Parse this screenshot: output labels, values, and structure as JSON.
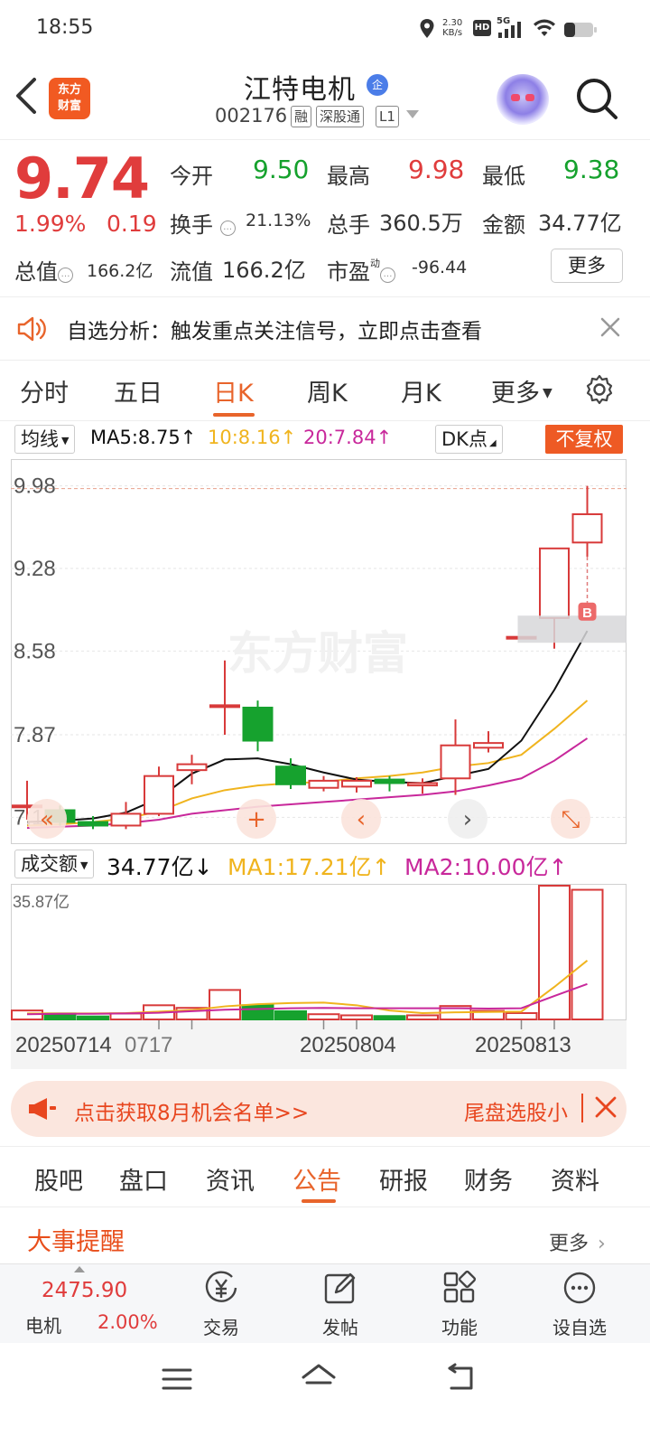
{
  "status_bar": {
    "time": "18:55",
    "net_speed_value": "2.30",
    "net_speed_unit": "KB/s",
    "hd_label": "HD",
    "network_label": "5G"
  },
  "header": {
    "logo_line1": "东方",
    "logo_line2": "财富",
    "stock_name": "江特电机",
    "badge": "企",
    "stock_code": "002176",
    "tags": [
      "融",
      "深股通",
      "L1"
    ]
  },
  "quote": {
    "price": "9.74",
    "change_pct": "1.99%",
    "change_amt": "0.19",
    "open_label": "今开",
    "open": "9.50",
    "high_label": "最高",
    "high": "9.98",
    "low_label": "最低",
    "low": "9.38",
    "turnover_label": "换手",
    "turnover": "21.13%",
    "volume_label": "总手",
    "volume": "360.5万",
    "amount_label": "金额",
    "amount": "34.77亿",
    "mktcap_label": "总值",
    "mktcap": "166.2亿",
    "float_label": "流值",
    "float_cap": "166.2亿",
    "pe_label": "市盈",
    "pe_sup": "动",
    "pe": "-96.44",
    "more": "更多"
  },
  "alert": {
    "text": "自选分析：触发重点关注信号，立即点击查看"
  },
  "chart_tabs": [
    "分时",
    "五日",
    "日K",
    "周K",
    "月K",
    "更多"
  ],
  "active_chart_tab": "日K",
  "indicators": {
    "ma_selector": "均线",
    "ma5": "MA5:8.75",
    "ma10": "10:8.16",
    "ma20": "20:7.84",
    "dk_button": "DK点",
    "adjust_button": "不复权",
    "ma5_color": "#111111",
    "ma10_color": "#f0b41e",
    "ma20_color": "#c8289b"
  },
  "chart_data": {
    "type": "candlestick",
    "y_ticks": [
      "9.98",
      "9.28",
      "8.58",
      "7.87",
      "7.17"
    ],
    "ylim": [
      7.05,
      10.1
    ],
    "x_labels": [
      "20250714",
      "0717",
      "20250804",
      "20250813"
    ],
    "watermark": "东方财富",
    "buy_marker": "B",
    "candles": [
      {
        "o": 7.27,
        "c": 7.27,
        "h": 7.48,
        "l": 7.15
      },
      {
        "o": 7.23,
        "c": 7.13,
        "h": 7.27,
        "l": 7.1
      },
      {
        "o": 7.13,
        "c": 7.1,
        "h": 7.18,
        "l": 7.07
      },
      {
        "o": 7.1,
        "c": 7.2,
        "h": 7.3,
        "l": 7.07
      },
      {
        "o": 7.2,
        "c": 7.52,
        "h": 7.6,
        "l": 7.18
      },
      {
        "o": 7.57,
        "c": 7.62,
        "h": 7.7,
        "l": 7.45
      },
      {
        "o": 8.12,
        "c": 8.12,
        "h": 8.5,
        "l": 7.87
      },
      {
        "o": 8.1,
        "c": 7.82,
        "h": 8.16,
        "l": 7.73
      },
      {
        "o": 7.6,
        "c": 7.45,
        "h": 7.67,
        "l": 7.41
      },
      {
        "o": 7.42,
        "c": 7.48,
        "h": 7.52,
        "l": 7.39
      },
      {
        "o": 7.43,
        "c": 7.48,
        "h": 7.51,
        "l": 7.38
      },
      {
        "o": 7.49,
        "c": 7.46,
        "h": 7.52,
        "l": 7.39
      },
      {
        "o": 7.44,
        "c": 7.46,
        "h": 7.5,
        "l": 7.37
      },
      {
        "o": 7.5,
        "c": 7.78,
        "h": 8.0,
        "l": 7.36
      },
      {
        "o": 7.76,
        "c": 7.8,
        "h": 7.9,
        "l": 7.72
      },
      {
        "o": 8.7,
        "c": 8.7,
        "h": 8.7,
        "l": 8.7
      },
      {
        "o": 8.86,
        "c": 9.45,
        "h": 9.45,
        "l": 8.6
      },
      {
        "o": 9.5,
        "c": 9.74,
        "h": 9.98,
        "l": 9.38
      }
    ],
    "ma5": [
      7.13,
      7.14,
      7.16,
      7.21,
      7.33,
      7.54,
      7.66,
      7.67,
      7.62,
      7.55,
      7.49,
      7.47,
      7.46,
      7.52,
      7.58,
      7.82,
      8.25,
      8.75
    ],
    "ma10": [
      7.1,
      7.11,
      7.13,
      7.16,
      7.22,
      7.33,
      7.4,
      7.44,
      7.46,
      7.47,
      7.5,
      7.52,
      7.55,
      7.6,
      7.63,
      7.7,
      7.92,
      8.16
    ],
    "ma20": [
      7.08,
      7.09,
      7.1,
      7.12,
      7.15,
      7.2,
      7.23,
      7.26,
      7.28,
      7.3,
      7.32,
      7.34,
      7.36,
      7.39,
      7.44,
      7.5,
      7.65,
      7.84
    ]
  },
  "volume": {
    "label": "成交额",
    "value": "34.77亿",
    "ma1": "MA1:17.21亿",
    "ma2": "MA2:10.00亿",
    "max_label": "35.87亿",
    "max": 35.87,
    "bars": [
      {
        "v": 2.4,
        "up": true
      },
      {
        "v": 1.6,
        "up": false
      },
      {
        "v": 0.8,
        "up": false
      },
      {
        "v": 1.6,
        "up": true
      },
      {
        "v": 3.8,
        "up": true
      },
      {
        "v": 3.1,
        "up": true
      },
      {
        "v": 7.9,
        "up": true
      },
      {
        "v": 3.8,
        "up": false
      },
      {
        "v": 2.2,
        "up": false
      },
      {
        "v": 1.4,
        "up": true
      },
      {
        "v": 1.1,
        "up": true
      },
      {
        "v": 0.9,
        "up": false
      },
      {
        "v": 1.1,
        "up": true
      },
      {
        "v": 3.6,
        "up": true
      },
      {
        "v": 2.3,
        "up": true
      },
      {
        "v": 1.7,
        "up": true
      },
      {
        "v": 35.87,
        "up": true
      },
      {
        "v": 34.77,
        "up": true
      }
    ],
    "ma1_line": [
      1.6,
      1.6,
      1.6,
      1.7,
      2.1,
      2.5,
      3.5,
      4.1,
      4.4,
      4.5,
      3.8,
      2.4,
      1.7,
      1.9,
      2.0,
      2.1,
      8.7,
      15.8
    ],
    "ma2_line": [
      1.4,
      1.5,
      1.5,
      1.6,
      1.8,
      2.2,
      2.6,
      2.8,
      3.0,
      3.1,
      3.0,
      3.0,
      3.0,
      3.0,
      2.9,
      3.0,
      6.3,
      9.5
    ]
  },
  "promo": {
    "text": "点击获取8月机会名单>>",
    "text2": "尾盘选股小"
  },
  "content_tabs": [
    "股吧",
    "盘口",
    "资讯",
    "公告",
    "研报",
    "财务",
    "资料"
  ],
  "active_content_tab": "公告",
  "events": {
    "title": "大事提醒",
    "more": "更多"
  },
  "toolbar": {
    "index_value": "2475.90",
    "index_name": "电机",
    "index_change": "2.00%",
    "trade": "交易",
    "post": "发帖",
    "func": "功能",
    "watch": "设自选"
  }
}
